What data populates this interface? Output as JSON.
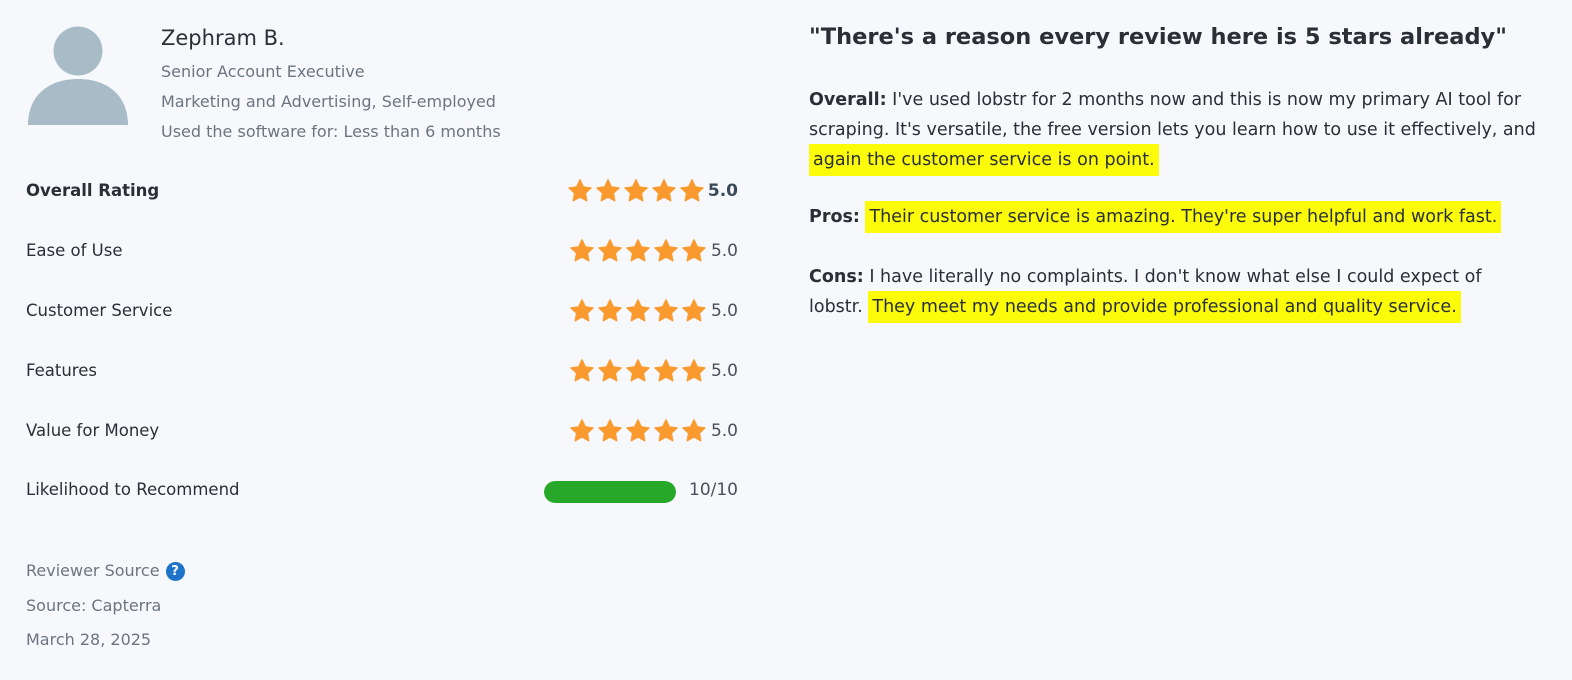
{
  "reviewer": {
    "name": "Zephram B.",
    "title": "Senior Account Executive",
    "company": "Marketing and Advertising, Self-employed",
    "usage": "Used the software for: Less than 6 months",
    "avatar_icon": "user-avatar-icon"
  },
  "ratings": {
    "overall": {
      "label": "Overall Rating",
      "value": "5.0",
      "stars": 5
    },
    "ease_of_use": {
      "label": "Ease of Use",
      "value": "5.0",
      "stars": 5
    },
    "customer_service": {
      "label": "Customer Service",
      "value": "5.0",
      "stars": 5
    },
    "features": {
      "label": "Features",
      "value": "5.0",
      "stars": 5
    },
    "value_for_money": {
      "label": "Value for Money",
      "value": "5.0",
      "stars": 5
    },
    "likelihood": {
      "label": "Likelihood to Recommend",
      "value": "10/10",
      "fraction": 1.0
    }
  },
  "source": {
    "reviewer_source_label": "Reviewer Source",
    "help_icon": "question-mark-icon",
    "source_text": "Source: Capterra",
    "date": "March 28, 2025"
  },
  "review": {
    "title": "\"There's a reason every review here is 5 stars already\"",
    "overall_label": "Overall:",
    "overall_text": " I've used lobstr for 2 months now and this is now my primary AI tool for scraping. It's versatile, the free version lets you learn how to use it effectively, and ",
    "overall_highlight": "again the customer service is on point. ",
    "pros_label": "Pros:",
    "pros_highlight": "Their customer service is amazing. They're super helpful and work fast. ",
    "cons_label": "Cons:",
    "cons_text": " I have literally no complaints. I don't know what else I could expect of lobstr. ",
    "cons_highlight": "They meet my needs and provide professional and quality service. "
  },
  "colors": {
    "star": "#fa9a2e",
    "progress": "#27a828",
    "highlight": "#fcfc0a",
    "help_icon": "#1f74c9",
    "avatar": "#a8bcc8",
    "background": "#f6f8fb"
  }
}
